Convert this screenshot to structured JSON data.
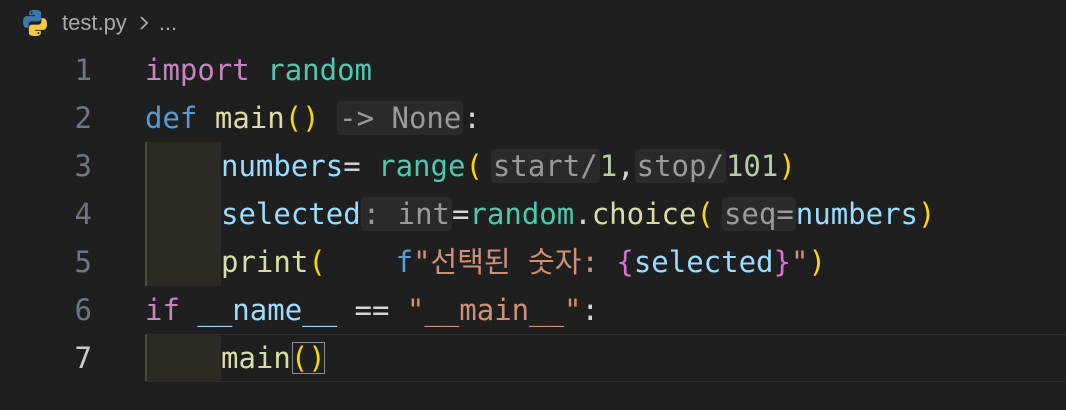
{
  "breadcrumb": {
    "file_icon": "python-icon",
    "file_name": "test.py",
    "separator_icon": "chevron-right-icon",
    "more": "..."
  },
  "editor": {
    "active_line": 7,
    "lines": [
      {
        "number": "1",
        "tokens": [
          {
            "t": "import",
            "c": "kw-pink"
          },
          {
            "t": " ",
            "c": ""
          },
          {
            "t": "random",
            "c": "mod"
          }
        ]
      },
      {
        "number": "2",
        "tokens": [
          {
            "t": "def",
            "c": "kw-blue"
          },
          {
            "t": " ",
            "c": ""
          },
          {
            "t": "main",
            "c": "fn"
          },
          {
            "t": "(",
            "c": "paren"
          },
          {
            "t": ")",
            "c": "paren"
          },
          {
            "t": " ",
            "c": ""
          },
          {
            "t": "-> None",
            "c": "hint"
          },
          {
            "t": ":",
            "c": "op"
          }
        ]
      },
      {
        "number": "3",
        "indent": true,
        "tokens": [
          {
            "t": "numbers",
            "c": "var"
          },
          {
            "t": "= ",
            "c": "op"
          },
          {
            "t": "range",
            "c": "mod"
          },
          {
            "t": "(",
            "c": "paren"
          },
          {
            "t": "gap",
            "c": "gap"
          },
          {
            "t": "start/",
            "c": "hint"
          },
          {
            "t": "1",
            "c": "num"
          },
          {
            "t": ",",
            "c": "op"
          },
          {
            "t": "stop/",
            "c": "hint"
          },
          {
            "t": "101",
            "c": "num"
          },
          {
            "t": ")",
            "c": "paren"
          }
        ]
      },
      {
        "number": "4",
        "indent": true,
        "tokens": [
          {
            "t": "selected",
            "c": "var"
          },
          {
            "t": ": int",
            "c": "hint"
          },
          {
            "t": "=",
            "c": "op"
          },
          {
            "t": "random",
            "c": "mod"
          },
          {
            "t": ".",
            "c": "op"
          },
          {
            "t": "choice",
            "c": "fn"
          },
          {
            "t": "(",
            "c": "paren"
          },
          {
            "t": "gap",
            "c": "gap"
          },
          {
            "t": "seq=",
            "c": "hint"
          },
          {
            "t": "numbers",
            "c": "var"
          },
          {
            "t": ")",
            "c": "paren"
          }
        ]
      },
      {
        "number": "5",
        "indent": true,
        "tokens": [
          {
            "t": "print",
            "c": "fn"
          },
          {
            "t": "(",
            "c": "paren"
          },
          {
            "t": "    ",
            "c": ""
          },
          {
            "t": "f",
            "c": "kw-blue"
          },
          {
            "t": "\"선택된 숫자: ",
            "c": "str"
          },
          {
            "t": "{",
            "c": "brace"
          },
          {
            "t": "selected",
            "c": "var"
          },
          {
            "t": "}",
            "c": "brace"
          },
          {
            "t": "\"",
            "c": "str"
          },
          {
            "t": ")",
            "c": "paren"
          }
        ]
      },
      {
        "number": "6",
        "tokens": [
          {
            "t": "if",
            "c": "kw-pink"
          },
          {
            "t": " ",
            "c": ""
          },
          {
            "t": "__name__",
            "c": "var"
          },
          {
            "t": " == ",
            "c": "op"
          },
          {
            "t": "\"__main__\"",
            "c": "str"
          },
          {
            "t": ":",
            "c": "op"
          }
        ]
      },
      {
        "number": "7",
        "indent": true,
        "tokens": [
          {
            "t": "main",
            "c": "fn"
          },
          {
            "t": "()",
            "c": "paren bracket-match"
          }
        ]
      }
    ]
  },
  "colors": {
    "background": "#1f1f1f",
    "keyword_control": "#c586c0",
    "keyword_def": "#569cd6",
    "type_module": "#4ec9b0",
    "function": "#dcdcaa",
    "variable": "#9cdcfe",
    "number": "#b5cea8",
    "string": "#ce9178",
    "bracket": "#ffd700",
    "inlay_hint": "#9a9a9a"
  }
}
